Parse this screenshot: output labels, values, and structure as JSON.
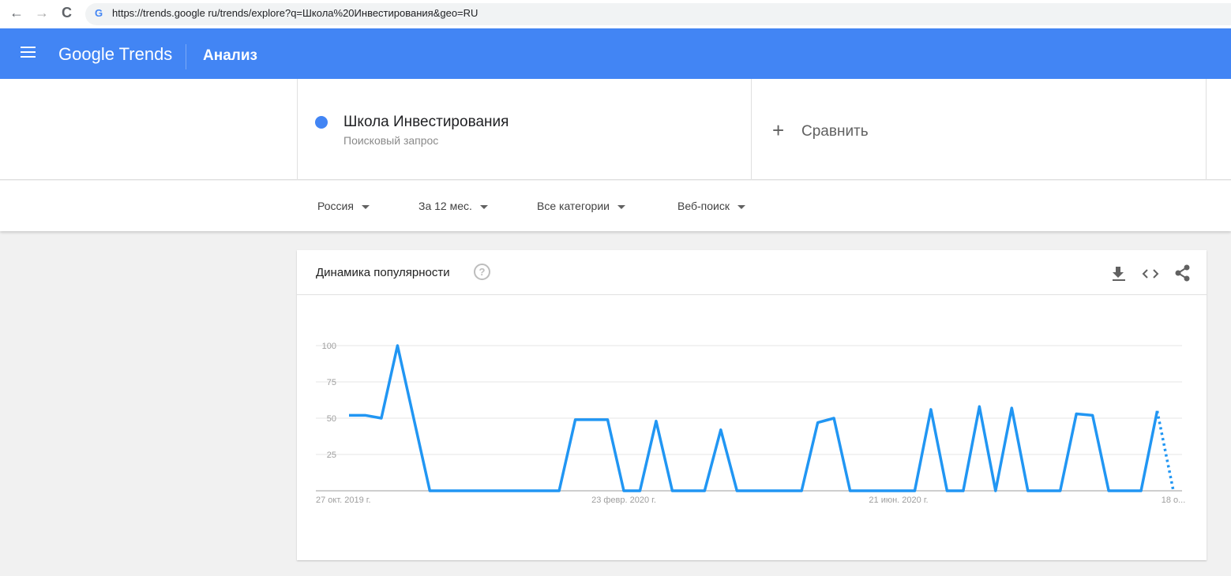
{
  "browser": {
    "url": "https://trends.google ru/trends/explore?q=Школа%20Инвестирования&geo=RU",
    "back_icon": "←",
    "forward_icon": "→",
    "reload_icon": "C"
  },
  "header": {
    "logo": "Google Trends",
    "title": "Анализ"
  },
  "search": {
    "term": "Школа Инвестирования",
    "term_type": "Поисковый запрос",
    "compare": "Сравнить",
    "term_color": "#4285f4"
  },
  "filters": [
    "Россия",
    "За 12 мес.",
    "Все категории",
    "Веб-поиск"
  ],
  "card": {
    "title": "Динамика популярности",
    "help": "?"
  },
  "chart_data": {
    "type": "line",
    "title": "Динамика популярности",
    "ylim": [
      0,
      100
    ],
    "yticks": [
      "100",
      "75",
      "50",
      "25"
    ],
    "ytick_values": [
      100,
      75,
      50,
      25
    ],
    "xtick_labels": [
      "27 окт. 2019 г.",
      "23 февр. 2020 г.",
      "21 июн. 2020 г.",
      "18 о..."
    ],
    "xtick_index": [
      0,
      17,
      34,
      51
    ],
    "series": [
      {
        "name": "Школа Инвестирования",
        "color": "#2196f3",
        "values": [
          52,
          52,
          50,
          100,
          50,
          0,
          0,
          0,
          0,
          0,
          0,
          0,
          0,
          0,
          49,
          49,
          49,
          0,
          0,
          48,
          0,
          0,
          0,
          42,
          0,
          0,
          0,
          0,
          0,
          47,
          50,
          0,
          0,
          0,
          0,
          0,
          56,
          0,
          0,
          58,
          0,
          57,
          0,
          0,
          0,
          53,
          52,
          0,
          0,
          0,
          55,
          0
        ],
        "partial_last": true
      }
    ]
  }
}
